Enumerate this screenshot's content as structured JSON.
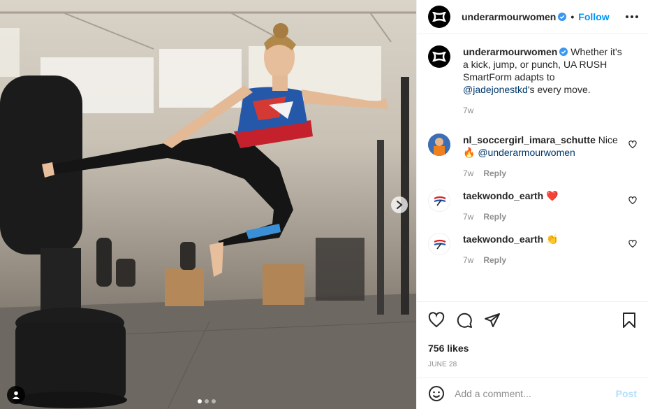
{
  "post": {
    "author": "underarmourwomen",
    "follow_label": "Follow",
    "separator": "•",
    "caption": {
      "username": "underarmourwomen",
      "text_before": " Whether it's a kick, jump, or punch, UA RUSH SmartForm adapts to ",
      "mention": "@jadejonestkd",
      "text_after": "'s every move.",
      "time": "7w"
    },
    "comments": [
      {
        "username": "nl_soccergirl_imara_schutte",
        "text": " Nice",
        "emoji": "🔥",
        "mention": "@underarmourwomen",
        "time": "7w",
        "reply_label": "Reply"
      },
      {
        "username": "taekwondo_earth",
        "emoji": "❤️",
        "time": "7w",
        "reply_label": "Reply"
      },
      {
        "username": "taekwondo_earth",
        "emoji": "👏",
        "time": "7w",
        "reply_label": "Reply"
      }
    ],
    "likes": "756 likes",
    "date": "JUNE 28"
  },
  "composer": {
    "placeholder": "Add a comment...",
    "post_label": "Post"
  },
  "icons": {
    "author_avatar": "under-armour-logo-icon",
    "verified": "verified-badge-icon",
    "more": "more-options-icon",
    "like": "heart-icon",
    "comment": "comment-icon",
    "share": "share-icon",
    "save": "bookmark-icon",
    "emoji": "emoji-icon",
    "next": "chevron-right-icon",
    "user_tag": "user-tag-icon"
  },
  "colors": {
    "accent": "#0095f6",
    "text": "#262626",
    "muted": "#8e8e8e",
    "verified": "#3897f0"
  },
  "carousel": {
    "count": 3,
    "active": 1
  }
}
